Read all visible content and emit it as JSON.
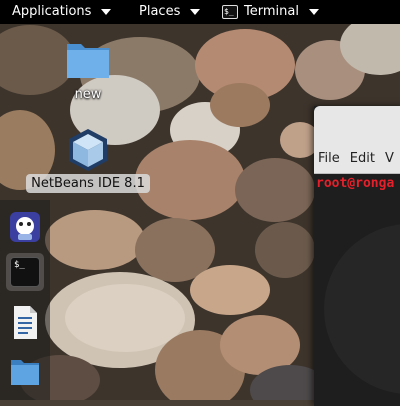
{
  "top_panel": {
    "applications_label": "Applications",
    "places_label": "Places",
    "terminal_label": "Terminal",
    "terminal_icon_text": "$_"
  },
  "desktop": {
    "icons": [
      {
        "label": "new",
        "icon": "folder-icon"
      },
      {
        "label": "NetBeans IDE 8.1",
        "icon": "netbeans-cube-icon"
      }
    ]
  },
  "dock": {
    "items": [
      {
        "icon": "ubuntu-bot-icon"
      },
      {
        "icon": "terminal-icon",
        "text": "$_"
      },
      {
        "icon": "text-document-icon"
      },
      {
        "icon": "folder-icon"
      }
    ]
  },
  "terminal_window": {
    "menu": [
      "File",
      "Edit",
      "V"
    ],
    "prompt": "root@ronga"
  },
  "colors": {
    "panel_bg": "#000000",
    "prompt_red": "#e5202b",
    "terminal_bg": "#1e1e1e",
    "menubar_bg": "#e7e7e7"
  }
}
